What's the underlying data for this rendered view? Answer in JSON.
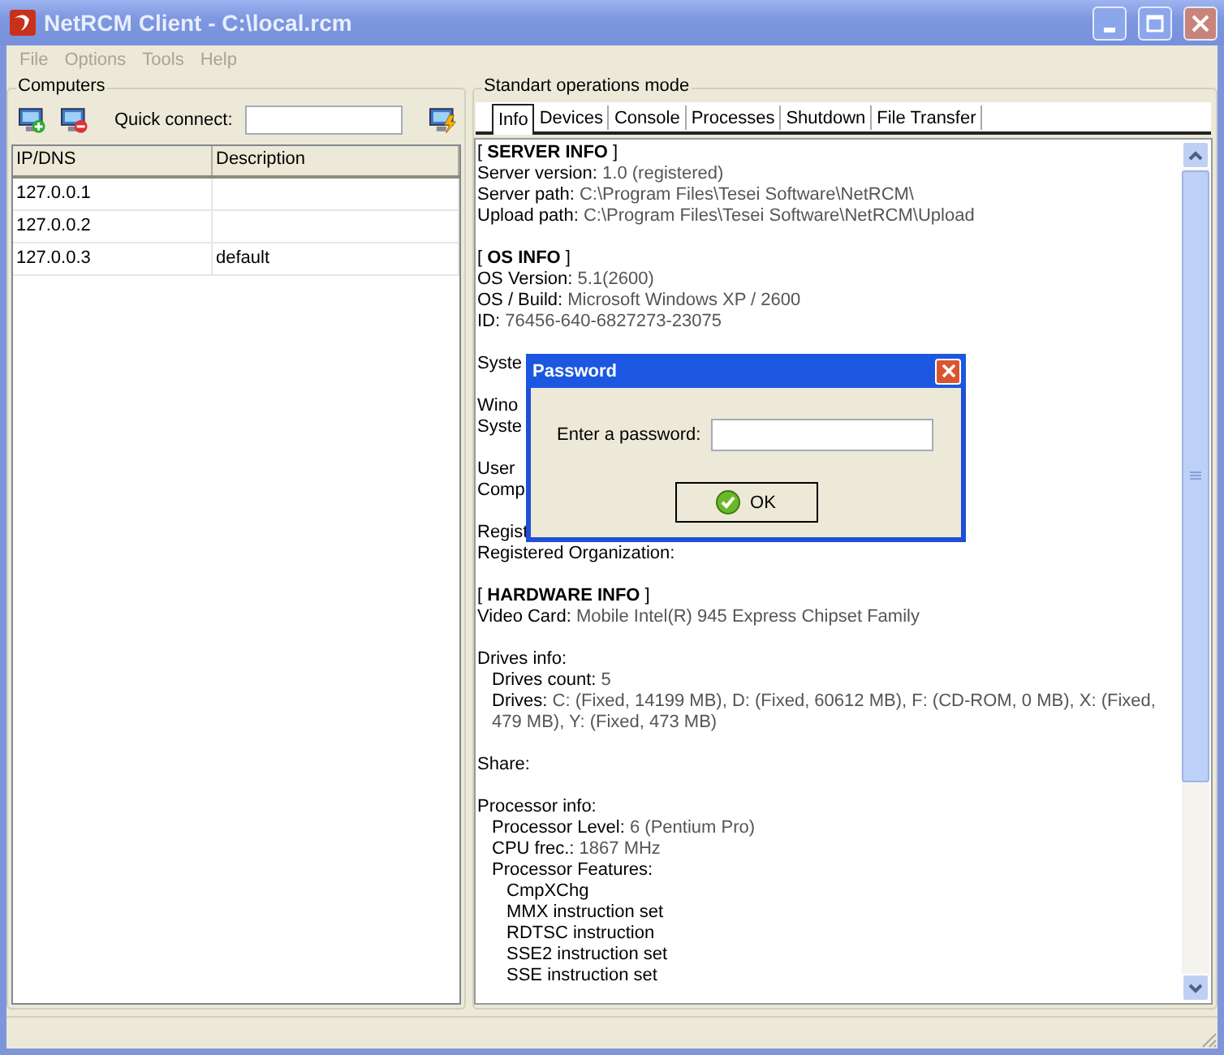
{
  "window": {
    "title": "NetRCM Client - C:\\local.rcm"
  },
  "menu": [
    "File",
    "Options",
    "Tools",
    "Help"
  ],
  "computers": {
    "title": "Computers",
    "quick_connect_label": "Quick connect:",
    "columns": [
      "IP/DNS",
      "Description"
    ],
    "rows": [
      {
        "ip": "127.0.0.1"
      },
      {
        "ip": "127.0.0.2"
      },
      {
        "ip": "127.0.0.3",
        "description": "default"
      }
    ]
  },
  "operations": {
    "title": "Standart operations mode",
    "tabs": [
      {
        "label": "Info",
        "selected": true
      },
      {
        "label": "Devices",
        "selected": false
      },
      {
        "label": "Console",
        "selected": false
      },
      {
        "label": "Processes",
        "selected": false
      },
      {
        "label": "Shutdown",
        "selected": false
      },
      {
        "label": "File Transfer",
        "selected": false
      }
    ],
    "info": [
      {
        "kind": "heading",
        "text": "[ **SERVER INFO** ]"
      },
      {
        "kind": "pair",
        "label": "Server version:",
        "value": "1.0 (registered)"
      },
      {
        "kind": "pair",
        "label": "Server path:",
        "value": "C:\\Program Files\\Tesei Software\\NetRCM\\"
      },
      {
        "kind": "pair",
        "label": "Upload path:",
        "value": "C:\\Program Files\\Tesei Software\\NetRCM\\Upload"
      },
      {
        "kind": "blank"
      },
      {
        "kind": "heading",
        "text": "[ **OS INFO** ]"
      },
      {
        "kind": "pair",
        "label": "OS Version:",
        "value": "5.1(2600)"
      },
      {
        "kind": "pair",
        "label": "OS / Build:",
        "value": "Microsoft Windows XP / 2600"
      },
      {
        "kind": "pair",
        "label": "ID:",
        "value": "76456-640-6827273-23075"
      },
      {
        "kind": "blank"
      },
      {
        "kind": "label",
        "text": "Syste"
      },
      {
        "kind": "blank"
      },
      {
        "kind": "label",
        "text": "Wino"
      },
      {
        "kind": "label",
        "text": "Syste"
      },
      {
        "kind": "blank"
      },
      {
        "kind": "label",
        "text": "User"
      },
      {
        "kind": "label",
        "text": "Comp"
      },
      {
        "kind": "blank"
      },
      {
        "kind": "label",
        "text": "Regist"
      },
      {
        "kind": "label",
        "text": "Registered Organization:"
      },
      {
        "kind": "blank"
      },
      {
        "kind": "heading",
        "text": "[ **HARDWARE INFO** ]"
      },
      {
        "kind": "pair",
        "label": "Video Card:",
        "value": "Mobile Intel(R) 945 Express Chipset Family"
      },
      {
        "kind": "blank"
      },
      {
        "kind": "label",
        "text": "Drives info:",
        "children": [
          {
            "kind": "pair",
            "label": "Drives count:",
            "value": "5"
          },
          {
            "kind": "pair",
            "label": "Drives:",
            "value": "C: (Fixed, 14199 MB), D: (Fixed, 60612 MB), F: (CD-ROM, 0 MB), X: (Fixed, 479 MB), Y: (Fixed, 473 MB)"
          }
        ]
      },
      {
        "kind": "blank"
      },
      {
        "kind": "label",
        "text": "Share:"
      },
      {
        "kind": "blank"
      },
      {
        "kind": "label",
        "text": "Processor info:",
        "children": [
          {
            "kind": "pair",
            "label": "Processor Level:",
            "value": "6 (Pentium Pro)"
          },
          {
            "kind": "pair",
            "label": "CPU frec.:",
            "value": "1867 MHz"
          },
          {
            "kind": "label",
            "text": "Processor Features:",
            "children": [
              {
                "kind": "label",
                "text": "CmpXChg"
              },
              {
                "kind": "label",
                "text": "MMX instruction set"
              },
              {
                "kind": "label",
                "text": "RDTSC instruction"
              },
              {
                "kind": "label",
                "text": "SSE2 instruction set"
              },
              {
                "kind": "label",
                "text": "SSE instruction set"
              }
            ]
          }
        ]
      }
    ]
  },
  "dialog": {
    "title": "Password",
    "label": "Enter a password:",
    "button": "OK"
  }
}
